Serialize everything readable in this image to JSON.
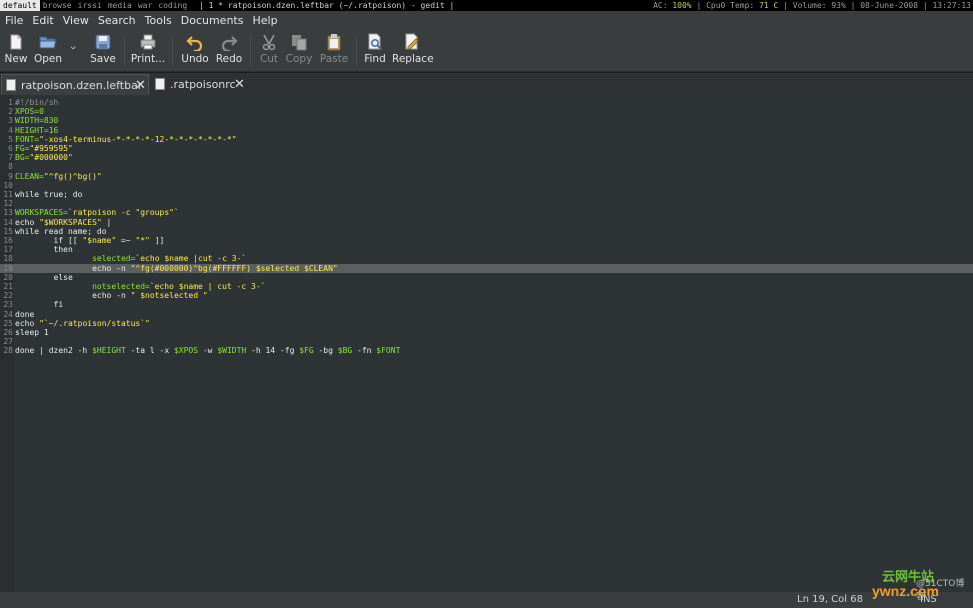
{
  "topbar": {
    "workspaces": [
      "default",
      "browse",
      "irssi",
      "media",
      "war",
      "coding"
    ],
    "active_workspace": "default",
    "window_title": "| 1 * ratpoison.dzen.leftbar (~/.ratpoison) - gedit |",
    "status_ac_label": "AC:",
    "status_ac_value": "100%",
    "status_cpu_label": "| Cpu0 Temp:",
    "status_cpu_value": "71 C",
    "status_rest": "| Volume: 93% | 08-June-2008 | 13:27:13"
  },
  "menu": [
    "File",
    "Edit",
    "View",
    "Search",
    "Tools",
    "Documents",
    "Help"
  ],
  "toolbar": {
    "new": "New",
    "open": "Open",
    "save": "Save",
    "print": "Print...",
    "undo": "Undo",
    "redo": "Redo",
    "cut": "Cut",
    "copy": "Copy",
    "paste": "Paste",
    "find": "Find",
    "replace": "Replace"
  },
  "tabs": [
    {
      "label": "ratpoison.dzen.leftbar",
      "active": true
    },
    {
      "label": ".ratpoisonrc",
      "active": false
    }
  ],
  "editor": {
    "current_line": 19,
    "lines": [
      [
        [
          "c-cm",
          "#!/bin/sh"
        ]
      ],
      [
        [
          "c-var",
          "XPOS=0"
        ]
      ],
      [
        [
          "c-var",
          "WIDTH=830"
        ]
      ],
      [
        [
          "c-var",
          "HEIGHT=16"
        ]
      ],
      [
        [
          "c-var",
          "FONT="
        ],
        [
          "c-str",
          "\"-xos4-terminus-*-*-*-*-12-*-*-*-*-*-*-*\""
        ]
      ],
      [
        [
          "c-var",
          "FG="
        ],
        [
          "c-str",
          "\"#959595\""
        ]
      ],
      [
        [
          "c-var",
          "BG="
        ],
        [
          "c-str",
          "\"#000000\""
        ]
      ],
      [],
      [
        [
          "c-var",
          "CLEAN="
        ],
        [
          "c-str",
          "\"^fg()^bg()\""
        ]
      ],
      [],
      [
        [
          "c-kw",
          "while true; do"
        ]
      ],
      [],
      [
        [
          "c-var",
          "WORKSPACES="
        ],
        [
          "c-str",
          "`ratpoison -c \"groups\"`"
        ]
      ],
      [
        [
          "c-kw",
          "echo "
        ],
        [
          "c-str",
          "\"$WORKSPACES\""
        ],
        [
          "c-kw",
          " |"
        ]
      ],
      [
        [
          "c-kw",
          "while read name; do"
        ]
      ],
      [
        [
          "c-kw",
          "        if [[ "
        ],
        [
          "c-str",
          "\"$name\""
        ],
        [
          "c-kw",
          " =~ "
        ],
        [
          "c-str",
          "\"*\""
        ],
        [
          "c-kw",
          " ]]"
        ]
      ],
      [
        [
          "c-kw",
          "        then"
        ]
      ],
      [
        [
          "c-kw",
          "                "
        ],
        [
          "c-var",
          "selected="
        ],
        [
          "c-str",
          "`echo $name |cut -c 3-`"
        ]
      ],
      [
        [
          "c-kw",
          "                echo -n "
        ],
        [
          "c-str",
          "\"^fg(#000000)^bg(#FFFFFF) $selected $CLEAN\""
        ]
      ],
      [
        [
          "c-kw",
          "        else"
        ]
      ],
      [
        [
          "c-kw",
          "                "
        ],
        [
          "c-var",
          "notselected="
        ],
        [
          "c-str",
          "`echo $name | cut -c 3-`"
        ]
      ],
      [
        [
          "c-kw",
          "                echo -n "
        ],
        [
          "c-str",
          "\" $notselected \""
        ]
      ],
      [
        [
          "c-kw",
          "        fi"
        ]
      ],
      [
        [
          "c-kw",
          "done"
        ]
      ],
      [
        [
          "c-kw",
          "echo "
        ],
        [
          "c-str",
          "\"`~/.ratpoison/status`\""
        ]
      ],
      [
        [
          "c-kw",
          "sleep 1"
        ]
      ],
      [],
      [
        [
          "c-kw",
          "done | dzen2 -h "
        ],
        [
          "c-var",
          "$HEIGHT"
        ],
        [
          "c-kw",
          " -ta l -x "
        ],
        [
          "c-var",
          "$XPOS"
        ],
        [
          "c-kw",
          " -w "
        ],
        [
          "c-var",
          "$WIDTH"
        ],
        [
          "c-kw",
          " -h 14 -fg "
        ],
        [
          "c-var",
          "$FG"
        ],
        [
          "c-kw",
          " -bg "
        ],
        [
          "c-var",
          "$BG"
        ],
        [
          "c-kw",
          " -fn "
        ],
        [
          "c-var",
          "$FONT"
        ]
      ]
    ]
  },
  "statusbar": {
    "position": "Ln 19, Col 68",
    "mode": "INS"
  },
  "watermark": {
    "line1": "云网牛站",
    "line2": "ywnz.com",
    "line3": "@51CTO博客"
  },
  "colors": {
    "background": "#2e3436",
    "variable": "#8ae234",
    "string": "#fce94f",
    "current_line": "#5c5f5f"
  }
}
